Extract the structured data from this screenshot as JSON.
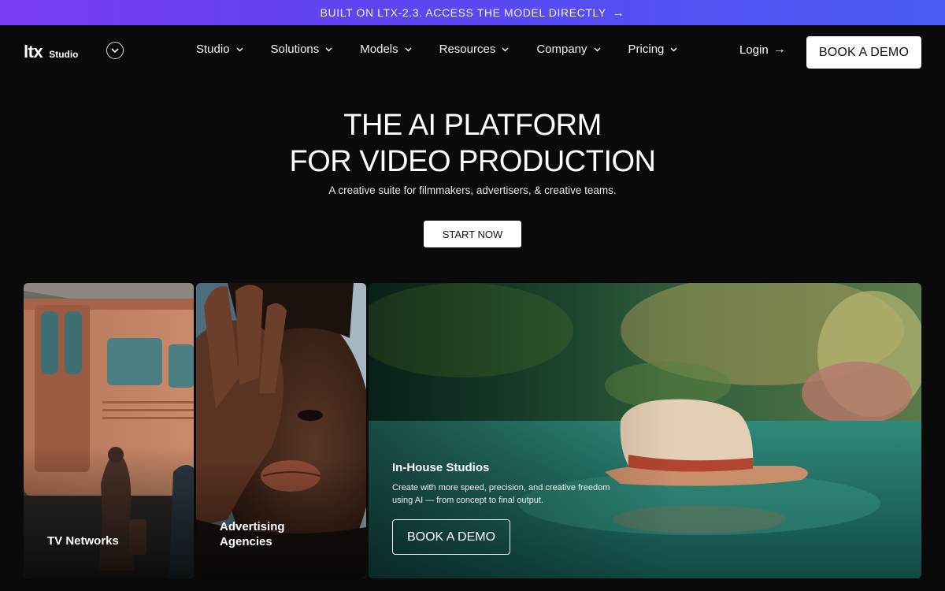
{
  "banner": {
    "text": "BUILT ON LTX-2.3. ACCESS THE MODEL DIRECTLY",
    "arrow": "→"
  },
  "nav": {
    "logo_mark": "LTX",
    "logo_sub": "Studio",
    "items": [
      {
        "label": "Studio"
      },
      {
        "label": "Solutions"
      },
      {
        "label": "Models"
      },
      {
        "label": "Resources"
      },
      {
        "label": "Company"
      },
      {
        "label": "Pricing"
      }
    ],
    "login_label": "Login",
    "login_arrow": "→",
    "demo_label": "BOOK A DEMO"
  },
  "hero": {
    "title_line1": "THE AI PLATFORM",
    "title_line2": "FOR VIDEO PRODUCTION",
    "subtitle": "A creative suite for filmmakers, advertisers, & creative teams.",
    "cta": "START NOW"
  },
  "cards": [
    {
      "label": "TV Networks"
    },
    {
      "label_line1": "Advertising",
      "label_line2": "Agencies"
    },
    {
      "title": "In-House Studios",
      "description": "Create with more speed, precision, and creative freedom using AI — from concept to final output.",
      "cta": "BOOK A DEMO"
    }
  ],
  "colors": {
    "banner_start": "#7a3cf2",
    "banner_end": "#4a5cf6",
    "background": "#0b0a0a"
  }
}
